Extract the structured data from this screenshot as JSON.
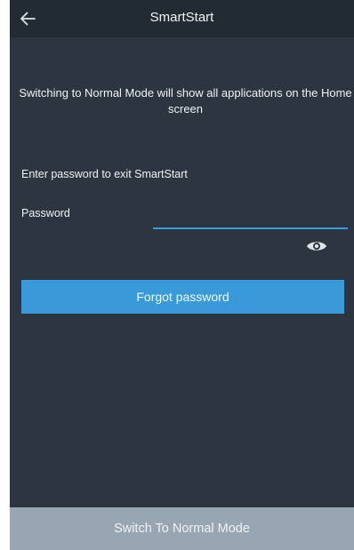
{
  "header": {
    "title": "SmartStart",
    "back_icon": "arrow-left-icon"
  },
  "info": {
    "message": "Switching to Normal Mode will show all applications on the Home screen"
  },
  "form": {
    "prompt": "Enter password to exit SmartStart",
    "password_label": "Password",
    "password_value": "",
    "toggle_visibility_icon": "eye-icon"
  },
  "actions": {
    "forgot_password": "Forgot password",
    "switch_mode": "Switch To Normal Mode"
  },
  "colors": {
    "background": "#2d3640",
    "app_bar": "#222a33",
    "accent": "#3a9ad9",
    "bottom_button": "#98a6b4"
  }
}
